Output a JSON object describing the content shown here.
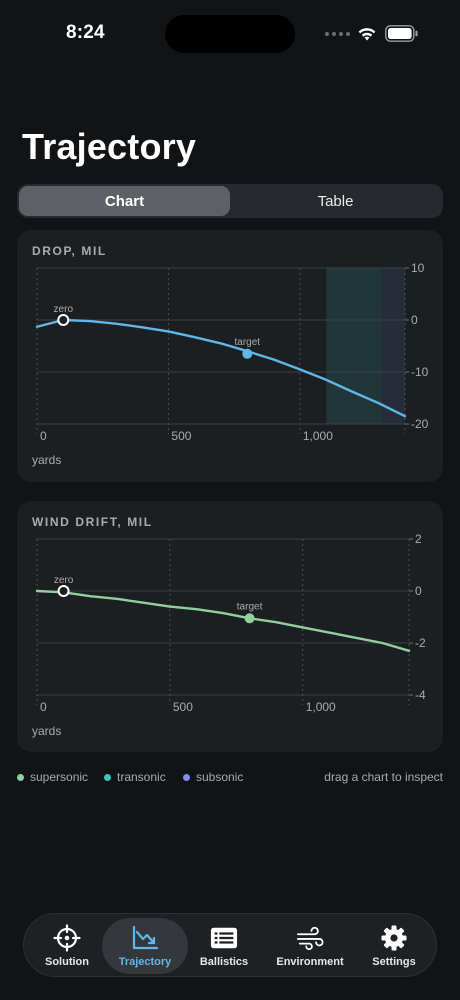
{
  "status_bar": {
    "time": "8:24"
  },
  "page_title": "Trajectory",
  "segmented": {
    "options": [
      "Chart",
      "Table"
    ],
    "selected": "Chart"
  },
  "colors": {
    "background": "#111315",
    "card": "#1c1f22",
    "supersonic": "#8fd19e",
    "transonic": "#3ec6c0",
    "subsonic": "#7f8cf2",
    "drop_line": "#5fb8e8",
    "accent": "#5fb8e8"
  },
  "drop_chart": {
    "title": "DROP, MIL",
    "x_unit": "yards",
    "x_ticks": [
      "0",
      "500",
      "1,000"
    ],
    "y_ticks": [
      "10",
      "0",
      "-10",
      "-20"
    ],
    "markers": {
      "zero": "zero",
      "target": "target"
    }
  },
  "wind_chart": {
    "title": "WIND DRIFT, MIL",
    "x_unit": "yards",
    "x_ticks": [
      "0",
      "500",
      "1,000"
    ],
    "y_ticks": [
      "2",
      "0",
      "-2",
      "-4"
    ],
    "markers": {
      "zero": "zero",
      "target": "target"
    }
  },
  "chart_data": [
    {
      "type": "line",
      "title": "DROP, MIL",
      "xlabel": "yards",
      "ylabel": "",
      "xlim": [
        0,
        1400
      ],
      "ylim": [
        -20,
        10
      ],
      "grid": true,
      "x": [
        0,
        100,
        200,
        300,
        400,
        500,
        600,
        700,
        800,
        900,
        1000,
        1100,
        1200,
        1300,
        1400
      ],
      "series": [
        {
          "values": [
            -1.3,
            0.0,
            -0.2,
            -0.7,
            -1.4,
            -2.2,
            -3.3,
            -4.5,
            -6.0,
            -7.6,
            -9.5,
            -11.5,
            -13.8,
            -16.0,
            -18.5
          ]
        }
      ],
      "points": [
        {
          "label": "zero",
          "x": 100,
          "y": 0
        },
        {
          "label": "target",
          "x": 800,
          "y": -6.5
        }
      ],
      "regions": [
        {
          "label": "transonic",
          "x_from": 1100,
          "x_to": 1310
        },
        {
          "label": "subsonic",
          "x_from": 1310,
          "x_to": 1400
        }
      ]
    },
    {
      "type": "line",
      "title": "WIND DRIFT, MIL",
      "xlabel": "yards",
      "ylabel": "",
      "xlim": [
        0,
        1400
      ],
      "ylim": [
        -4,
        2
      ],
      "grid": true,
      "x": [
        0,
        100,
        200,
        300,
        400,
        500,
        600,
        700,
        800,
        900,
        1000,
        1100,
        1200,
        1300,
        1400
      ],
      "series": [
        {
          "values": [
            0.0,
            -0.05,
            -0.2,
            -0.3,
            -0.45,
            -0.6,
            -0.7,
            -0.85,
            -1.05,
            -1.2,
            -1.4,
            -1.6,
            -1.8,
            -2.0,
            -2.3
          ]
        }
      ],
      "points": [
        {
          "label": "zero",
          "x": 100,
          "y": 0
        },
        {
          "label": "target",
          "x": 800,
          "y": -1.05
        }
      ]
    }
  ],
  "legend": {
    "items": [
      {
        "label": "supersonic",
        "color": "#8fd19e"
      },
      {
        "label": "transonic",
        "color": "#3ec6c0"
      },
      {
        "label": "subsonic",
        "color": "#7f8cf2"
      }
    ],
    "hint": "drag a chart to inspect"
  },
  "tabbar": {
    "items": [
      {
        "label": "Solution",
        "icon": "crosshair-icon"
      },
      {
        "label": "Trajectory",
        "icon": "chart-icon"
      },
      {
        "label": "Ballistics",
        "icon": "list-icon"
      },
      {
        "label": "Environment",
        "icon": "wind-icon"
      },
      {
        "label": "Settings",
        "icon": "gear-icon"
      }
    ],
    "active": "Trajectory"
  }
}
